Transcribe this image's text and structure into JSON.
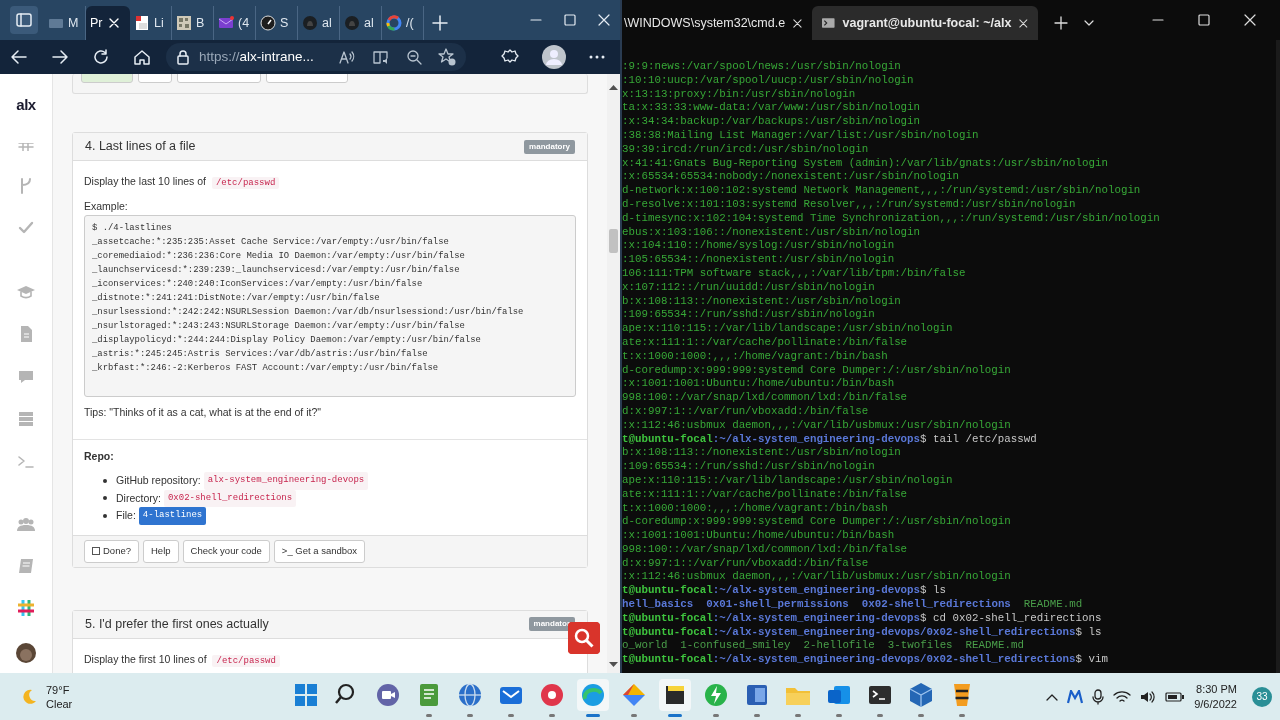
{
  "browser": {
    "tabs": [
      {
        "label": "M",
        "selected": false
      },
      {
        "label": "Pr",
        "selected": true
      },
      {
        "label": "Li",
        "selected": false
      },
      {
        "label": "B",
        "selected": false
      },
      {
        "label": "(4",
        "selected": false
      },
      {
        "label": "S",
        "selected": false
      },
      {
        "label": "al",
        "selected": false
      },
      {
        "label": "al",
        "selected": false
      },
      {
        "label": "/(",
        "selected": false
      }
    ],
    "url_scheme": "https://",
    "url_rest": "alx-intrane..."
  },
  "page": {
    "logo": "alx",
    "tasks": [
      {
        "title": "4. Last lines of a file",
        "badge": "mandatory",
        "intro": "Display the last 10 lines of",
        "intro_code": "/etc/passwd",
        "example_label": "Example:",
        "example": [
          "$ ./4-lastlines",
          "_assetcache:*:235:235:Asset Cache Service:/var/empty:/usr/bin/false",
          "_coremediaiod:*:236:236:Core Media IO Daemon:/var/empty:/usr/bin/false",
          "_launchservicesd:*:239:239:_launchservicesd:/var/empty:/usr/bin/false",
          "_iconservices:*:240:240:IconServices:/var/empty:/usr/bin/false",
          "_distnote:*:241:241:DistNote:/var/empty:/usr/bin/false",
          "_nsurlsessiond:*:242:242:NSURLSession Daemon:/var/db/nsurlsessiond:/usr/bin/false",
          "_nsurlstoraged:*:243:243:NSURLStorage Daemon:/var/empty:/usr/bin/false",
          "_displaypolicyd:*:244:244:Display Policy Daemon:/var/empty:/usr/bin/false",
          "_astris:*:245:245:Astris Services:/var/db/astris:/usr/bin/false",
          "_krbfast:*:246:-2:Kerberos FAST Account:/var/empty:/usr/bin/false"
        ],
        "tips": "Tips: \"Thinks of it as a cat, what is at the end of it?\"",
        "repo_label": "Repo:",
        "repo": [
          {
            "label": "GitHub repository:",
            "value": "alx-system_engineering-devops",
            "highlighted": false
          },
          {
            "label": "Directory:",
            "value": "0x02-shell_redirections",
            "highlighted": false
          },
          {
            "label": "File:",
            "value": "4-lastlines",
            "highlighted": true
          }
        ],
        "buttons": [
          {
            "kind": "checkbox",
            "label": "Done?",
            "checked": false
          },
          {
            "kind": "plain",
            "label": "Help"
          },
          {
            "kind": "plain",
            "label": "Check your code"
          },
          {
            "kind": "sandbox",
            "prefix": ">_",
            "label": "Get a sandbox"
          }
        ]
      },
      {
        "title": "5. I'd prefer the first ones actually",
        "badge": "mandator",
        "intro": "Display the first 10 lines of",
        "intro_code": "/etc/passwd"
      }
    ]
  },
  "terminal": {
    "tabs": [
      {
        "title": "\\WINDOWS\\system32\\cmd.e",
        "selected": false
      },
      {
        "title": "vagrant@ubuntu-focal: ~/alx",
        "selected": true
      }
    ],
    "lines": [
      {
        "kind": "output",
        "text": ":9:9:news:/var/spool/news:/usr/sbin/nologin"
      },
      {
        "kind": "output",
        "text": ":10:10:uucp:/var/spool/uucp:/usr/sbin/nologin"
      },
      {
        "kind": "output",
        "text": "x:13:13:proxy:/bin:/usr/sbin/nologin"
      },
      {
        "kind": "output",
        "text": "ta:x:33:33:www-data:/var/www:/usr/sbin/nologin"
      },
      {
        "kind": "output",
        "text": ":x:34:34:backup:/var/backups:/usr/sbin/nologin"
      },
      {
        "kind": "output",
        "text": ":38:38:Mailing List Manager:/var/list:/usr/sbin/nologin"
      },
      {
        "kind": "output",
        "text": "39:39:ircd:/run/ircd:/usr/sbin/nologin"
      },
      {
        "kind": "output",
        "text": "x:41:41:Gnats Bug-Reporting System (admin):/var/lib/gnats:/usr/sbin/nologin"
      },
      {
        "kind": "output",
        "text": ":x:65534:65534:nobody:/nonexistent:/usr/sbin/nologin"
      },
      {
        "kind": "output",
        "text": "d-network:x:100:102:systemd Network Management,,,:/run/systemd:/usr/sbin/nologin"
      },
      {
        "kind": "output",
        "text": "d-resolve:x:101:103:systemd Resolver,,,:/run/systemd:/usr/sbin/nologin"
      },
      {
        "kind": "output",
        "text": "d-timesync:x:102:104:systemd Time Synchronization,,,:/run/systemd:/usr/sbin/nologin"
      },
      {
        "kind": "output",
        "text": "ebus:x:103:106::/nonexistent:/usr/sbin/nologin"
      },
      {
        "kind": "output",
        "text": ":x:104:110::/home/syslog:/usr/sbin/nologin"
      },
      {
        "kind": "output",
        "text": ":105:65534::/nonexistent:/usr/sbin/nologin"
      },
      {
        "kind": "output",
        "text": "106:111:TPM software stack,,,:/var/lib/tpm:/bin/false"
      },
      {
        "kind": "output",
        "text": "x:107:112::/run/uuidd:/usr/sbin/nologin"
      },
      {
        "kind": "output",
        "text": "b:x:108:113::/nonexistent:/usr/sbin/nologin"
      },
      {
        "kind": "output",
        "text": ":109:65534::/run/sshd:/usr/sbin/nologin"
      },
      {
        "kind": "output",
        "text": "ape:x:110:115::/var/lib/landscape:/usr/sbin/nologin"
      },
      {
        "kind": "output",
        "text": "ate:x:111:1::/var/cache/pollinate:/bin/false"
      },
      {
        "kind": "output",
        "text": "t:x:1000:1000:,,,:/home/vagrant:/bin/bash"
      },
      {
        "kind": "output",
        "text": "d-coredump:x:999:999:systemd Core Dumper:/:/usr/sbin/nologin"
      },
      {
        "kind": "output",
        "text": ":x:1001:1001:Ubuntu:/home/ubuntu:/bin/bash"
      },
      {
        "kind": "output",
        "text": "998:100::/var/snap/lxd/common/lxd:/bin/false"
      },
      {
        "kind": "output",
        "text": "d:x:997:1::/var/run/vboxadd:/bin/false"
      },
      {
        "kind": "output",
        "text": ":x:112:46:usbmux daemon,,,:/var/lib/usbmux:/usr/sbin/nologin"
      },
      {
        "kind": "prompt",
        "user": "t@ubuntu-focal",
        "path": ":~/alx-system_engineering-devops",
        "command": "$ tail /etc/passwd"
      },
      {
        "kind": "output",
        "text": "b:x:108:113::/nonexistent:/usr/sbin/nologin"
      },
      {
        "kind": "output",
        "text": ":109:65534::/run/sshd:/usr/sbin/nologin"
      },
      {
        "kind": "output",
        "text": "ape:x:110:115::/var/lib/landscape:/usr/sbin/nologin"
      },
      {
        "kind": "output",
        "text": "ate:x:111:1::/var/cache/pollinate:/bin/false"
      },
      {
        "kind": "output",
        "text": "t:x:1000:1000:,,,:/home/vagrant:/bin/bash"
      },
      {
        "kind": "output",
        "text": "d-coredump:x:999:999:systemd Core Dumper:/:/usr/sbin/nologin"
      },
      {
        "kind": "output",
        "text": ":x:1001:1001:Ubuntu:/home/ubuntu:/bin/bash"
      },
      {
        "kind": "output",
        "text": "998:100::/var/snap/lxd/common/lxd:/bin/false"
      },
      {
        "kind": "output",
        "text": "d:x:997:1::/var/run/vboxadd:/bin/false"
      },
      {
        "kind": "output",
        "text": ":x:112:46:usbmux daemon,,,:/var/lib/usbmux:/usr/sbin/nologin"
      },
      {
        "kind": "prompt",
        "user": "t@ubuntu-focal",
        "path": ":~/alx-system_engineering-devops",
        "command": "$ ls"
      },
      {
        "kind": "listing",
        "entries": [
          {
            "kind": "dir",
            "text": "hell_basics"
          },
          {
            "kind": "dir",
            "text": "0x01-shell_permissions"
          },
          {
            "kind": "dir",
            "text": "0x02-shell_redirections"
          },
          {
            "kind": "file",
            "text": "README.md"
          }
        ]
      },
      {
        "kind": "prompt",
        "user": "t@ubuntu-focal",
        "path": ":~/alx-system_engineering-devops",
        "command": "$ cd 0x02-shell_redirections"
      },
      {
        "kind": "prompt",
        "user": "t@ubuntu-focal",
        "path": ":~/alx-system_engineering-devops/0x02-shell_redirections",
        "command": "$ ls"
      },
      {
        "kind": "listing",
        "entries": [
          {
            "kind": "file",
            "text": "o_world"
          },
          {
            "kind": "file",
            "text": "1-confused_smiley"
          },
          {
            "kind": "file",
            "text": "2-hellofile"
          },
          {
            "kind": "file",
            "text": "3-twofiles"
          },
          {
            "kind": "file",
            "text": "README.md"
          }
        ]
      },
      {
        "kind": "prompt",
        "user": "t@ubuntu-focal",
        "path": ":~/alx-system_engineering-devops/0x02-shell_redirections",
        "command": "$ vim"
      }
    ]
  },
  "taskbar": {
    "weather": {
      "temp": "79°F",
      "condition": "Clear"
    },
    "apps": [
      {
        "kind": "start",
        "running": false,
        "active": false
      },
      {
        "kind": "search",
        "running": false,
        "active": false
      },
      {
        "kind": "video",
        "running": false,
        "active": false
      },
      {
        "kind": "notepad",
        "running": true,
        "active": false
      },
      {
        "kind": "globe",
        "running": true,
        "active": false
      },
      {
        "kind": "mail",
        "running": true,
        "active": false
      },
      {
        "kind": "record",
        "running": true,
        "active": false
      },
      {
        "kind": "browser",
        "running": true,
        "active": true
      },
      {
        "kind": "diamond",
        "running": true,
        "active": false
      },
      {
        "kind": "sticky",
        "running": true,
        "active": true
      },
      {
        "kind": "bolt",
        "running": true,
        "active": false
      },
      {
        "kind": "doc",
        "running": true,
        "active": false
      },
      {
        "kind": "folder",
        "running": true,
        "active": false
      },
      {
        "kind": "envelope",
        "running": true,
        "active": false
      },
      {
        "kind": "terminal",
        "running": true,
        "active": false
      },
      {
        "kind": "cube",
        "running": true,
        "active": false
      },
      {
        "kind": "media",
        "running": true,
        "active": false
      }
    ],
    "clock": {
      "time": "8:30 PM",
      "date": "9/6/2022"
    },
    "notifications": "33"
  }
}
